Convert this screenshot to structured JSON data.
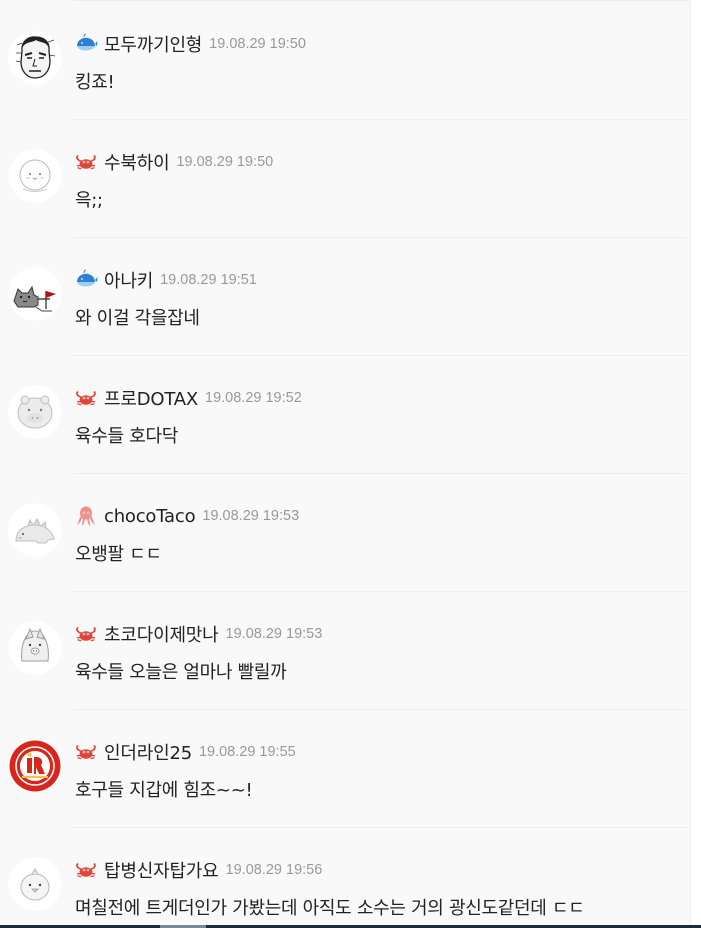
{
  "comments": [
    {
      "nickname": "모두까기인형",
      "time": "19.08.29 19:50",
      "text": "킹죠!",
      "level_icon": "whale-icon",
      "avatar": "drawn-face-avatar"
    },
    {
      "nickname": "수북하이",
      "time": "19.08.29 19:50",
      "text": "윽;;",
      "level_icon": "crab-icon",
      "avatar": "round-bun-avatar"
    },
    {
      "nickname": "아나키",
      "time": "19.08.29 19:51",
      "text": "와 이걸 각을잡네",
      "level_icon": "whale-icon",
      "avatar": "cat-flag-avatar"
    },
    {
      "nickname": "프로DOTAX",
      "time": "19.08.29 19:52",
      "text": "육수들 호다닥",
      "level_icon": "crab-icon",
      "avatar": "hippo-avatar"
    },
    {
      "nickname": "chocoTaco",
      "time": "19.08.29 19:53",
      "text": "오뱅팔 ㄷㄷ",
      "level_icon": "octopus-icon",
      "avatar": "dino-avatar"
    },
    {
      "nickname": "초코다이제맛나",
      "time": "19.08.29 19:53",
      "text": "육수들 오늘은 얼마나 빨릴까",
      "level_icon": "crab-icon",
      "avatar": "pig-avatar"
    },
    {
      "nickname": "인더라인25",
      "time": "19.08.29 19:55",
      "text": "호구들 지갑에 힘조~~!",
      "level_icon": "crab-icon",
      "avatar": "red-logo-avatar"
    },
    {
      "nickname": "탑병신자탑가요",
      "time": "19.08.29 19:56",
      "text": "며칠전에 트게더인가 가봤는데 아직도 소수는 거의 광신도같던데 ㄷㄷ",
      "level_icon": "crab-icon",
      "avatar": "chick-avatar"
    }
  ],
  "colors": {
    "background": "#f9f9f9",
    "nickname": "#222222",
    "timestamp": "#999999",
    "crab": "#e0453a",
    "whale": "#2f7fd6",
    "octopus": "#f08f8f",
    "logo_red": "#d9261c"
  }
}
